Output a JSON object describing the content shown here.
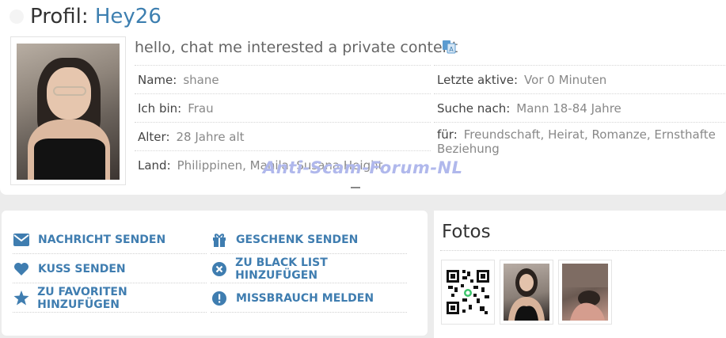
{
  "profile": {
    "title_prefix": "Profil:",
    "nickname": "Hey26",
    "status_message": "hello, chat me interested a private content",
    "name_label": "Name:",
    "name_value": "shane",
    "gender_label": "Ich bin:",
    "gender_value": "Frau",
    "age_label": "Alter:",
    "age_value": "28 Jahre alt",
    "country_label": "Land:",
    "country_value": "Philippinen, Manila, Susana Height",
    "last_active_label": "Letzte aktive:",
    "last_active_value": "Vor 0 Minuten",
    "looking_label": "Suche nach:",
    "looking_value": "Mann 18-84 Jahre",
    "for_label": "für:",
    "for_value": "Freundschaft, Heirat, Romanze, Ernsthafte Beziehung"
  },
  "watermark": "Anti-Scam-Forum-NL",
  "actions": {
    "send_message": "NACHRICHT SENDEN",
    "send_kiss": "KUSS SENDEN",
    "add_favorite": "ZU FAVORITEN HINZUFÜGEN",
    "send_gift": "GESCHENK SENDEN",
    "add_blacklist": "ZU BLACK LIST HINZUFÜGEN",
    "report_abuse": "MISSBRAUCH MELDEN"
  },
  "photos": {
    "title": "Fotos"
  },
  "colors": {
    "accent": "#3f7db0",
    "nickname": "#3d7fb0",
    "background": "#ececec"
  },
  "icons": [
    "envelope-icon",
    "heart-icon",
    "star-icon",
    "gift-icon",
    "x-circle-icon",
    "exclamation-circle-icon",
    "translate-icon"
  ]
}
